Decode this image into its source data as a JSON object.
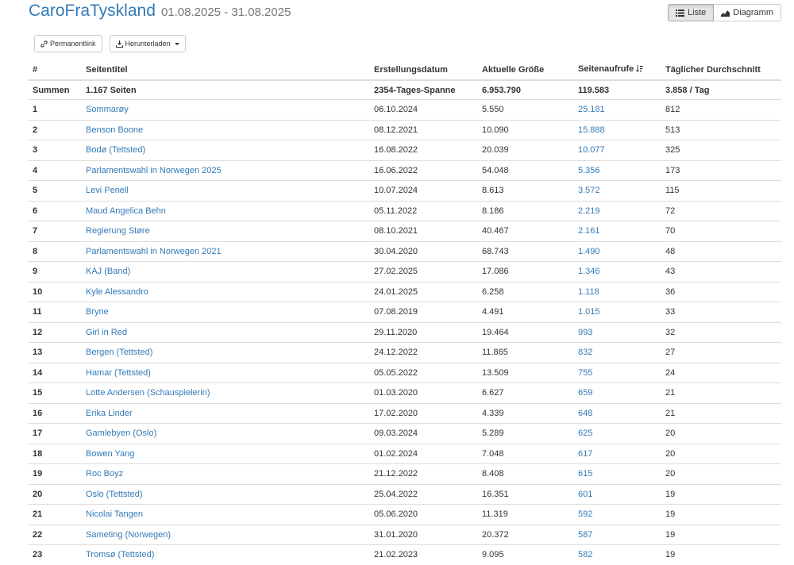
{
  "header": {
    "user": "CaroFraTyskland",
    "date_range": "01.08.2025 - 31.08.2025"
  },
  "view_toggle": {
    "list_label": "Liste",
    "chart_label": "Diagramm"
  },
  "toolbar": {
    "permalink_label": "Permanentlink",
    "download_label": "Herunterladen"
  },
  "table": {
    "columns": [
      "#",
      "Seitentitel",
      "Erstellungsdatum",
      "Aktuelle Größe",
      "Seitenaufrufe",
      "Täglicher Durchschnitt"
    ],
    "summary": {
      "label": "Summen",
      "pages": "1.167 Seiten",
      "span": "2354-Tages-Spanne",
      "size": "6.953.790",
      "views": "119.583",
      "avg": "3.858 / Tag"
    },
    "rows": [
      {
        "n": "1",
        "title": "Sommarøy",
        "date": "06.10.2024",
        "size": "5.550",
        "views": "25.181",
        "avg": "812"
      },
      {
        "n": "2",
        "title": "Benson Boone",
        "date": "08.12.2021",
        "size": "10.090",
        "views": "15.888",
        "avg": "513"
      },
      {
        "n": "3",
        "title": "Bodø (Tettsted)",
        "date": "16.08.2022",
        "size": "20.039",
        "views": "10.077",
        "avg": "325"
      },
      {
        "n": "4",
        "title": "Parlamentswahl in Norwegen 2025",
        "date": "16.06.2022",
        "size": "54.048",
        "views": "5.356",
        "avg": "173"
      },
      {
        "n": "5",
        "title": "Levi Penell",
        "date": "10.07.2024",
        "size": "8.613",
        "views": "3.572",
        "avg": "115"
      },
      {
        "n": "6",
        "title": "Maud Angelica Behn",
        "date": "05.11.2022",
        "size": "8.186",
        "views": "2.219",
        "avg": "72"
      },
      {
        "n": "7",
        "title": "Regierung Støre",
        "date": "08.10.2021",
        "size": "40.467",
        "views": "2.161",
        "avg": "70"
      },
      {
        "n": "8",
        "title": "Parlamentswahl in Norwegen 2021",
        "date": "30.04.2020",
        "size": "68.743",
        "views": "1.490",
        "avg": "48"
      },
      {
        "n": "9",
        "title": "KAJ (Band)",
        "date": "27.02.2025",
        "size": "17.086",
        "views": "1.346",
        "avg": "43"
      },
      {
        "n": "10",
        "title": "Kyle Alessandro",
        "date": "24.01.2025",
        "size": "6.258",
        "views": "1.118",
        "avg": "36"
      },
      {
        "n": "11",
        "title": "Bryne",
        "date": "07.08.2019",
        "size": "4.491",
        "views": "1.015",
        "avg": "33"
      },
      {
        "n": "12",
        "title": "Girl in Red",
        "date": "29.11.2020",
        "size": "19.464",
        "views": "993",
        "avg": "32"
      },
      {
        "n": "13",
        "title": "Bergen (Tettsted)",
        "date": "24.12.2022",
        "size": "11.865",
        "views": "832",
        "avg": "27"
      },
      {
        "n": "14",
        "title": "Hamar (Tettsted)",
        "date": "05.05.2022",
        "size": "13.509",
        "views": "755",
        "avg": "24"
      },
      {
        "n": "15",
        "title": "Lotte Andersen (Schauspielerin)",
        "date": "01.03.2020",
        "size": "6.627",
        "views": "659",
        "avg": "21"
      },
      {
        "n": "16",
        "title": "Erika Linder",
        "date": "17.02.2020",
        "size": "4.339",
        "views": "648",
        "avg": "21"
      },
      {
        "n": "17",
        "title": "Gamlebyen (Oslo)",
        "date": "09.03.2024",
        "size": "5.289",
        "views": "625",
        "avg": "20"
      },
      {
        "n": "18",
        "title": "Bowen Yang",
        "date": "01.02.2024",
        "size": "7.048",
        "views": "617",
        "avg": "20"
      },
      {
        "n": "19",
        "title": "Roc Boyz",
        "date": "21.12.2022",
        "size": "8.408",
        "views": "615",
        "avg": "20"
      },
      {
        "n": "20",
        "title": "Oslo (Tettsted)",
        "date": "25.04.2022",
        "size": "16.351",
        "views": "601",
        "avg": "19"
      },
      {
        "n": "21",
        "title": "Nicolai Tangen",
        "date": "05.06.2020",
        "size": "11.319",
        "views": "592",
        "avg": "19"
      },
      {
        "n": "22",
        "title": "Sameting (Norwegen)",
        "date": "31.01.2020",
        "size": "20.372",
        "views": "587",
        "avg": "19"
      },
      {
        "n": "23",
        "title": "Tromsø (Tettsted)",
        "date": "21.02.2023",
        "size": "9.095",
        "views": "582",
        "avg": "19"
      }
    ]
  }
}
